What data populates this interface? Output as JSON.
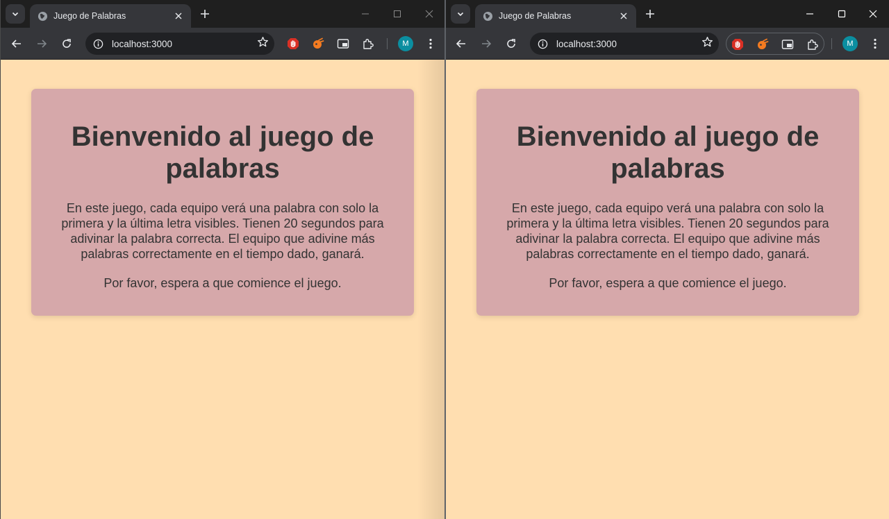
{
  "windows": [
    {
      "tab": {
        "title": "Juego de Palabras",
        "favicon": "globe-icon"
      },
      "omnibox": {
        "url": "localhost:3000",
        "info_icon": "info-icon"
      },
      "profile": {
        "initial": "M"
      },
      "window_controls": [
        "minimize-icon",
        "maximize-icon",
        "close-icon"
      ],
      "extensions": [
        "stop-hand-extension-icon",
        "orange-extension-icon",
        "window-extension-icon",
        "puzzle-icon"
      ],
      "page": {
        "heading": "Bienvenido al juego de palabras",
        "description": "En este juego, cada equipo verá una palabra con solo la primera y la última letra visibles. Tienen 20 segundos para adivinar la palabra correcta. El equipo que adivine más palabras correctamente en el tiempo dado, ganará.",
        "wait_message": "Por favor, espera a que comience el juego."
      }
    },
    {
      "tab": {
        "title": "Juego de Palabras",
        "favicon": "globe-icon"
      },
      "omnibox": {
        "url": "localhost:3000",
        "info_icon": "info-icon"
      },
      "profile": {
        "initial": "M"
      },
      "window_controls": [
        "minimize-icon",
        "maximize-icon",
        "close-icon"
      ],
      "extensions": [
        "stop-hand-extension-icon",
        "orange-extension-icon",
        "window-extension-icon",
        "puzzle-icon"
      ],
      "page": {
        "heading": "Bienvenido al juego de palabras",
        "description": "En este juego, cada equipo verá una palabra con solo la primera y la última letra visibles. Tienen 20 segundos para adivinar la palabra correcta. El equipo que adivine más palabras correctamente en el tiempo dado, ganará.",
        "wait_message": "Por favor, espera a que comience el juego."
      }
    }
  ],
  "colors": {
    "page_background": "#ffdeb0",
    "card_background": "#d6a8aa",
    "text": "#333333",
    "chrome_frame": "#1f1f1f",
    "chrome_toolbar": "#35363a",
    "avatar": "#0b8ea0"
  }
}
